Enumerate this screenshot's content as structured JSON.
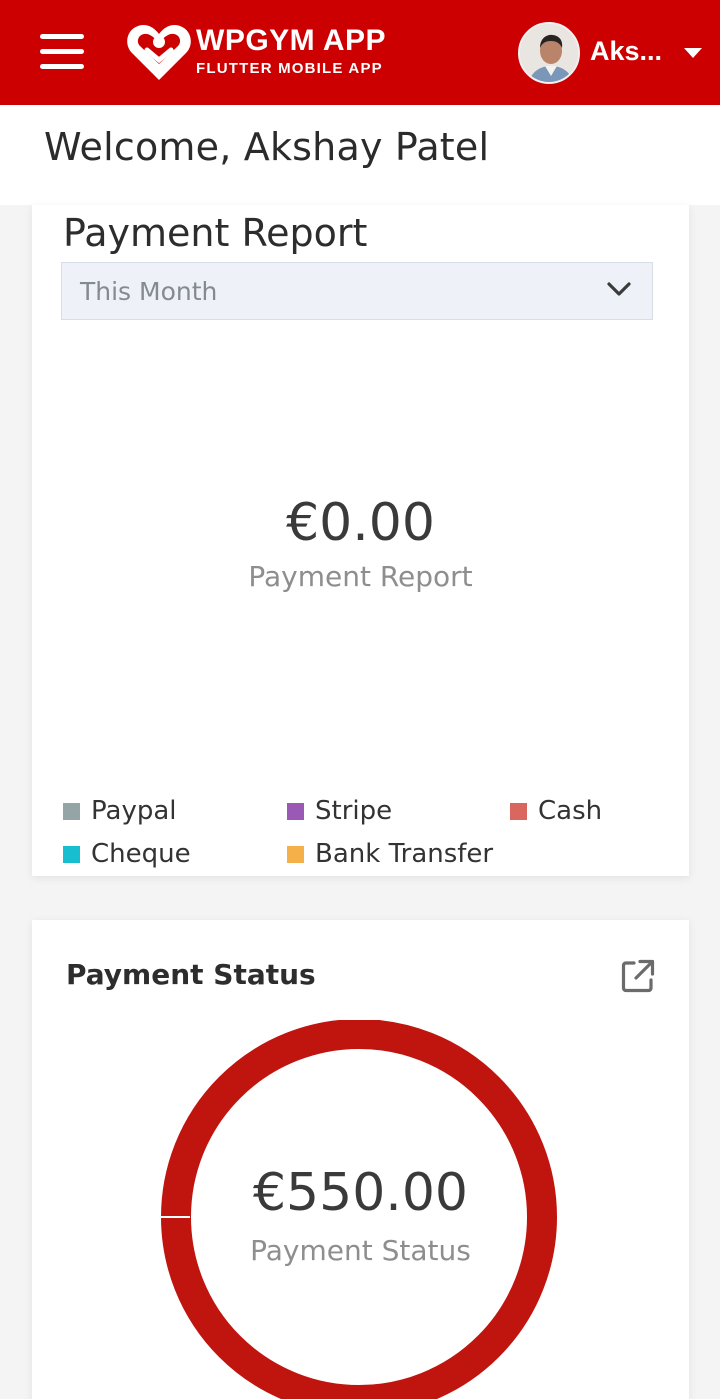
{
  "header": {
    "brand_title": "WPGYM APP",
    "brand_subtitle": "FLUTTER MOBILE APP",
    "user_name": "Aks...",
    "accent_color": "#cc0000"
  },
  "welcome": {
    "text": "Welcome, Akshay Patel"
  },
  "payment_report": {
    "title": "Payment Report",
    "period_selected": "This Month",
    "amount": "€0.00",
    "caption": "Payment Report",
    "legend": [
      {
        "label": "Paypal",
        "color": "#95a5a6"
      },
      {
        "label": "Stripe",
        "color": "#9b59b6"
      },
      {
        "label": "Cash",
        "color": "#d9675f"
      },
      {
        "label": "Cheque",
        "color": "#17becf"
      },
      {
        "label": "Bank Transfer",
        "color": "#f5b04a"
      }
    ]
  },
  "payment_status": {
    "title": "Payment Status",
    "amount": "€550.00",
    "caption": "Payment Status",
    "ring_color": "#c0150f"
  },
  "icons": {
    "menu": "hamburger-icon",
    "brand": "heart-logo-icon",
    "dropdown": "caret-down-icon",
    "select": "chevron-down-icon",
    "open": "external-link-icon"
  }
}
